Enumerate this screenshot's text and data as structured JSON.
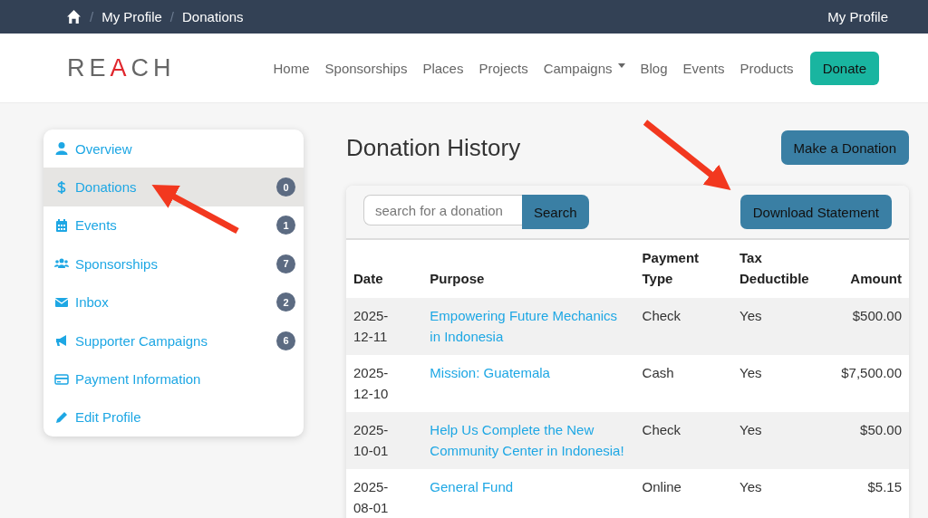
{
  "breadcrumb": {
    "parts": [
      {
        "kind": "separator",
        "text": "/"
      },
      {
        "kind": "link",
        "text": "My Profile"
      },
      {
        "kind": "separator",
        "text": "/"
      },
      {
        "kind": "current",
        "text": "Donations"
      }
    ]
  },
  "top_bar": {
    "profile_link": "My Profile"
  },
  "header": {
    "logo": [
      {
        "text": "RE",
        "accent": false
      },
      {
        "text": "A",
        "accent": true
      },
      {
        "text": "CH",
        "accent": false
      }
    ],
    "nav": [
      {
        "label": "Home",
        "dropdown": false
      },
      {
        "label": "Sponsorships",
        "dropdown": false
      },
      {
        "label": "Places",
        "dropdown": false
      },
      {
        "label": "Projects",
        "dropdown": false
      },
      {
        "label": "Campaigns",
        "dropdown": true
      },
      {
        "label": "Blog",
        "dropdown": false
      },
      {
        "label": "Events",
        "dropdown": false
      },
      {
        "label": "Products",
        "dropdown": false
      }
    ],
    "donate_button": "Donate"
  },
  "sidebar": {
    "items": [
      {
        "label": "Overview",
        "selected": false
      },
      {
        "label": "Donations",
        "selected": true,
        "count": "0"
      },
      {
        "label": "Events",
        "selected": false,
        "count": "1"
      },
      {
        "label": "Sponsorships",
        "selected": false,
        "count": "7"
      },
      {
        "label": "Inbox",
        "selected": false,
        "count": "2"
      },
      {
        "label": "Supporter Campaigns",
        "selected": false,
        "count": "6"
      },
      {
        "label": "Payment Information",
        "selected": false
      },
      {
        "label": "Edit Profile",
        "selected": false
      }
    ]
  },
  "main": {
    "title": "Donation History",
    "make_donation_button": "Make a Donation",
    "search": {
      "placeholder": "search for a donation",
      "button": "Search"
    },
    "download_button": "Download Statement",
    "table": {
      "columns": [
        "Date",
        "Purpose",
        "Payment Type",
        "Tax Deductible",
        "Amount"
      ],
      "rows": [
        [
          "2025-12-11",
          "Empowering Future Mechanics in Indonesia",
          "Check",
          "Yes",
          "$500.00"
        ],
        [
          "2025-12-10",
          "Mission: Guatemala",
          "Cash",
          "Yes",
          "$7,500.00"
        ],
        [
          "2025-10-01",
          "Help Us Complete the New Community Center in Indonesia!",
          "Check",
          "Yes",
          "$50.00"
        ],
        [
          "2025-08-01",
          "General Fund",
          "Online",
          "Yes",
          "$5.15"
        ]
      ]
    }
  }
}
